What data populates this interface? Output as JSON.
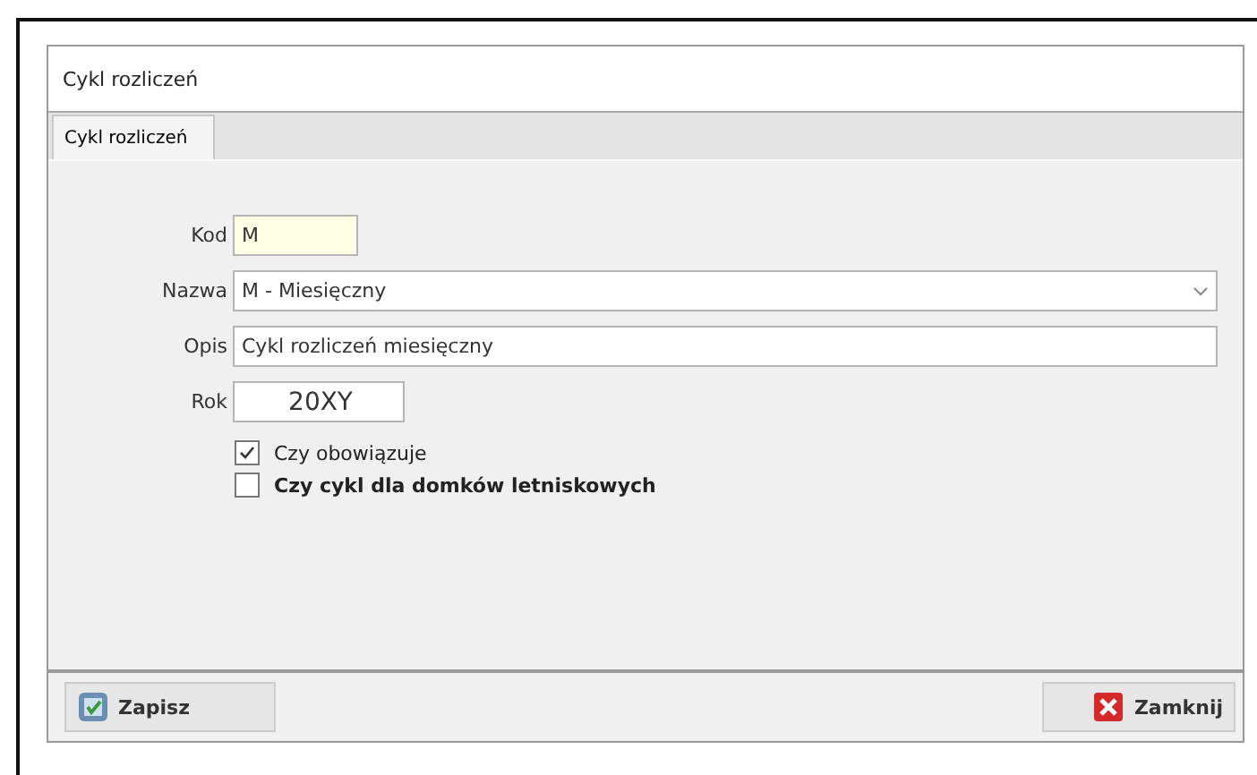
{
  "window": {
    "title": "Cykl rozliczeń"
  },
  "tabs": [
    {
      "label": "Cykl rozliczeń",
      "selected": true
    }
  ],
  "form": {
    "kod": {
      "label": "Kod",
      "value": "M"
    },
    "nazwa": {
      "label": "Nazwa",
      "value": "M - Miesięczny"
    },
    "opis": {
      "label": "Opis",
      "value": "Cykl rozliczeń miesięczny"
    },
    "rok": {
      "label": "Rok",
      "value": "20XY"
    }
  },
  "checkboxes": [
    {
      "label": "Czy obowiązuje",
      "checked": true,
      "bold": false
    },
    {
      "label": "Czy cykl dla domków letniskowych",
      "checked": false,
      "bold": true
    }
  ],
  "buttons": [
    {
      "label": "Zapisz",
      "kind": "save"
    },
    {
      "label": "Zamknij",
      "kind": "close"
    }
  ]
}
